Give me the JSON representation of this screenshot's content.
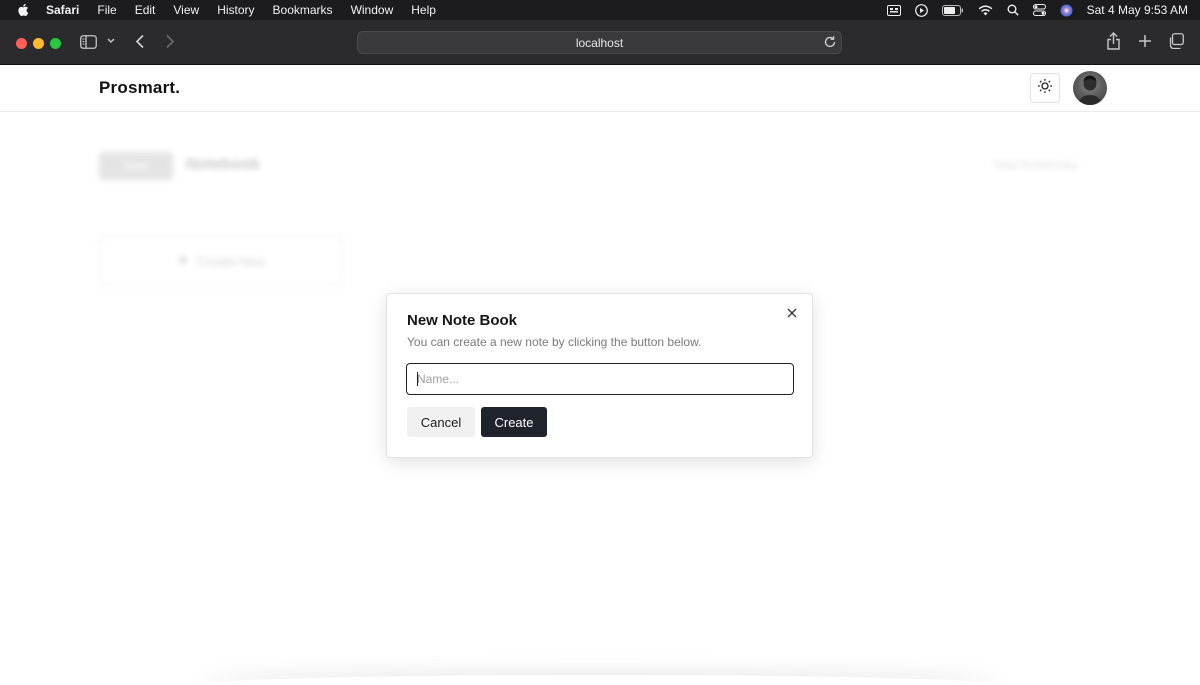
{
  "menubar": {
    "app_name": "Safari",
    "items": [
      "File",
      "Edit",
      "View",
      "History",
      "Bookmarks",
      "Window",
      "Help"
    ],
    "clock": "Sat 4 May  9:53 AM"
  },
  "browser": {
    "url": "localhost"
  },
  "nav": {
    "brand": "Prosmart."
  },
  "background": {
    "button_label": "New",
    "title": "Notebook",
    "right_text": "Total Notebooks",
    "card_label": "Create New"
  },
  "dialog": {
    "title": "New Note Book",
    "description": "You can create a new note by clicking the button below.",
    "input_value": "",
    "input_placeholder": "Name...",
    "cancel_label": "Cancel",
    "create_label": "Create"
  },
  "colors": {
    "primary_button": "#1f232c",
    "secondary_button": "#f1f1f1"
  }
}
